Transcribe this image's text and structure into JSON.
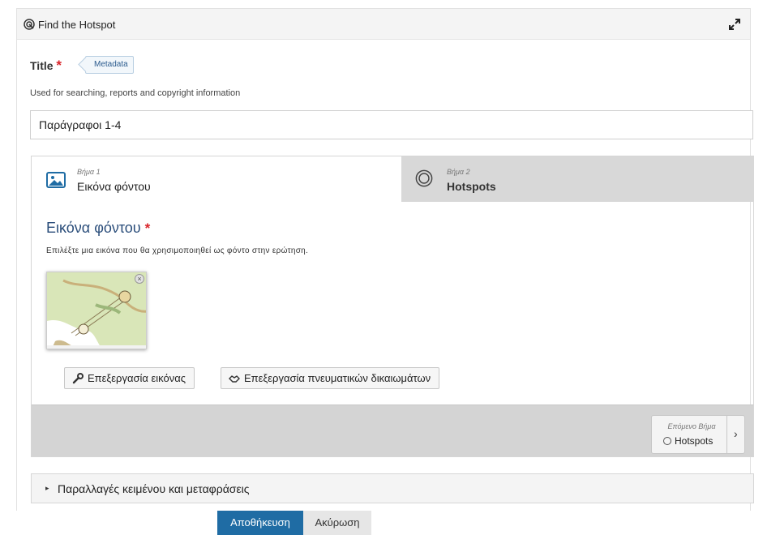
{
  "header": {
    "title": "Find the Hotspot",
    "icon": "hotspot-icon",
    "expand_icon": "expand-icon"
  },
  "title_field": {
    "label": "Title",
    "required_mark": "*",
    "metadata_button": "Metadata",
    "description": "Used for searching, reports and copyright information",
    "value": "Παράγραφοι 1-4"
  },
  "wizard": {
    "tabs": [
      {
        "step": "Βήμα 1",
        "name": "Εικόνα φόντου",
        "icon": "image-icon",
        "active": true
      },
      {
        "step": "Βήμα 2",
        "name": "Hotspots",
        "icon": "target-icon",
        "active": false
      }
    ],
    "section_title": "Εικόνα φόντου",
    "required_mark": "*",
    "section_description": "Επιλέξτε μια εικόνα που θα χρησιμοποιηθεί ως φόντο στην ερώτηση.",
    "thumbnail_close": "×",
    "edit_image_button": "Επεξεργασία εικόνας",
    "edit_copyright_button": "Επεξεργασία πνευματικών δικαιωμάτων",
    "next": {
      "label": "Επόμενο Βήμα",
      "name": "Hotspots",
      "chevron": "›"
    }
  },
  "accordion": {
    "arrow": "▸",
    "label": "Παραλλαγές κειμένου και μεταφράσεις"
  },
  "actions": {
    "save": "Αποθήκευση",
    "cancel": "Ακύρωση"
  },
  "colors": {
    "accent": "#1f6ca4",
    "required": "#d9242a",
    "heading": "#2a4d7a"
  }
}
